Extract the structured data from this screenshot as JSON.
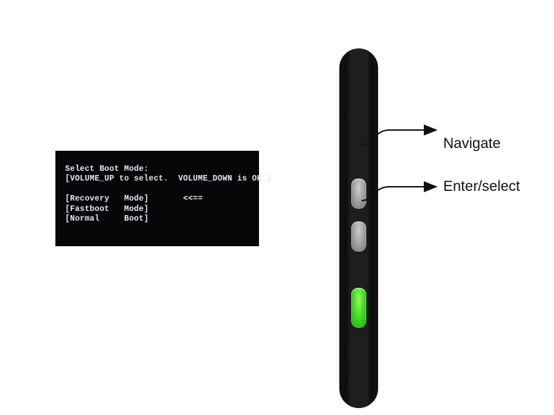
{
  "boot_screen": {
    "title": "Select Boot Mode:",
    "instruction": "[VOLUME_UP to select.  VOLUME_DOWN is OK.]",
    "options": [
      {
        "col1": "[Recovery",
        "col2": "Mode]",
        "marker": "<<=="
      },
      {
        "col1": "[Fastboot",
        "col2": "Mode]",
        "marker": ""
      },
      {
        "col1": "[Normal",
        "col2": "Boot]",
        "marker": ""
      }
    ]
  },
  "callouts": {
    "navigate": "Navigate",
    "enter": "Enter/select"
  }
}
